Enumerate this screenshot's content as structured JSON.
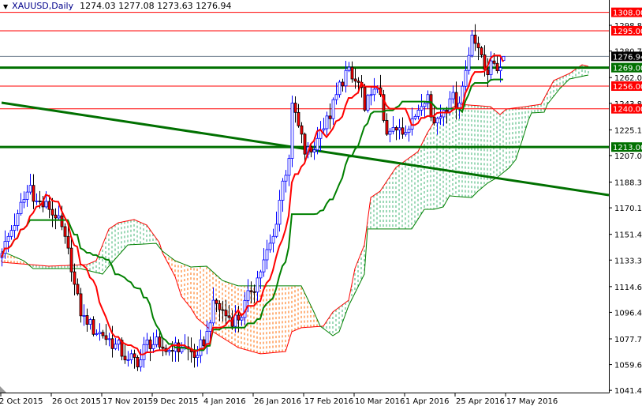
{
  "header": {
    "symbol": "XAUUSD,Daily",
    "ohlc": "1274.03 1277.08 1273.63 1276.94",
    "open": 1274.03,
    "high": 1277.08,
    "low": 1273.63,
    "close": 1276.94
  },
  "colors": {
    "bull": "#0000ff",
    "bear_body": "#ff0000",
    "bear_wick": "#000000",
    "tenkan": "#ff0000",
    "kijun": "#008000",
    "span_a": "#ff0000",
    "span_b": "#008000",
    "cloud_bull": "#3cb371",
    "cloud_bear": "#ff6a00",
    "support": "#ff0000",
    "resistance_green": "#007000",
    "price_line": "#708090"
  },
  "chart_data": {
    "type": "candlestick",
    "title": "XAUUSD,Daily",
    "ylim": [
      1041.45,
      1316.7
    ],
    "y_ticks": [
      "1298.85",
      "1280.70",
      "1262.00",
      "1243.85",
      "1225.15",
      "1207.00",
      "1188.30",
      "1170.15",
      "1151.45",
      "1133.30",
      "1114.60",
      "1096.45",
      "1077.75",
      "1059.60",
      "1041.45"
    ],
    "x_ticks": [
      {
        "bar": 0,
        "label": "2 Oct 2015"
      },
      {
        "bar": 16,
        "label": "26 Oct 2015"
      },
      {
        "bar": 32,
        "label": "17 Nov 2015"
      },
      {
        "bar": 48,
        "label": "9 Dec 2015"
      },
      {
        "bar": 64,
        "label": "4 Jan 2016"
      },
      {
        "bar": 80,
        "label": "26 Jan 2016"
      },
      {
        "bar": 96,
        "label": "17 Feb 2016"
      },
      {
        "bar": 112,
        "label": "10 Mar 2016"
      },
      {
        "bar": 128,
        "label": "1 Apr 2016"
      },
      {
        "bar": 144,
        "label": "25 Apr 2016"
      },
      {
        "bar": 160,
        "label": "17 May 2016"
      }
    ],
    "bar_count": 160,
    "close_keypoints": [
      [
        0,
        1138
      ],
      [
        5,
        1166
      ],
      [
        9,
        1186
      ],
      [
        11,
        1175
      ],
      [
        15,
        1169
      ],
      [
        17,
        1163
      ],
      [
        20,
        1150
      ],
      [
        22,
        1125
      ],
      [
        25,
        1094
      ],
      [
        27,
        1088
      ],
      [
        32,
        1080
      ],
      [
        36,
        1074
      ],
      [
        40,
        1063
      ],
      [
        44,
        1063
      ],
      [
        46,
        1077
      ],
      [
        50,
        1072
      ],
      [
        54,
        1069
      ],
      [
        57,
        1072
      ],
      [
        62,
        1066
      ],
      [
        65,
        1083
      ],
      [
        67,
        1105
      ],
      [
        71,
        1094
      ],
      [
        75,
        1091
      ],
      [
        79,
        1111
      ],
      [
        82,
        1125
      ],
      [
        86,
        1150
      ],
      [
        89,
        1189
      ],
      [
        91,
        1205
      ],
      [
        92,
        1244
      ],
      [
        94,
        1228
      ],
      [
        96,
        1208
      ],
      [
        99,
        1211
      ],
      [
        101,
        1225
      ],
      [
        104,
        1233
      ],
      [
        106,
        1250
      ],
      [
        109,
        1267
      ],
      [
        111,
        1261
      ],
      [
        114,
        1255
      ],
      [
        115,
        1239
      ],
      [
        117,
        1250
      ],
      [
        120,
        1250
      ],
      [
        122,
        1222
      ],
      [
        125,
        1225
      ],
      [
        127,
        1222
      ],
      [
        130,
        1233
      ],
      [
        132,
        1239
      ],
      [
        135,
        1250
      ],
      [
        137,
        1230
      ],
      [
        140,
        1239
      ],
      [
        142,
        1247
      ],
      [
        145,
        1244
      ],
      [
        147,
        1267
      ],
      [
        149,
        1292
      ],
      [
        151,
        1283
      ],
      [
        152,
        1278
      ],
      [
        154,
        1264
      ],
      [
        156,
        1272
      ],
      [
        158,
        1269
      ],
      [
        159,
        1276.94
      ]
    ],
    "senkou_a": [
      [
        0,
        1131.8
      ],
      [
        15,
        1129.0
      ],
      [
        27,
        1130.1
      ],
      [
        30,
        1132.9
      ],
      [
        34,
        1155.2
      ],
      [
        37,
        1159.6
      ],
      [
        42,
        1161.9
      ],
      [
        46,
        1158.0
      ],
      [
        50,
        1145.7
      ],
      [
        51,
        1138.5
      ],
      [
        55,
        1121.7
      ],
      [
        57,
        1107.8
      ],
      [
        60,
        1099.5
      ],
      [
        62,
        1092.2
      ],
      [
        67,
        1082.8
      ],
      [
        75,
        1071.6
      ],
      [
        82,
        1067.2
      ],
      [
        90,
        1068.8
      ],
      [
        92,
        1082.8
      ],
      [
        95,
        1085.6
      ],
      [
        102,
        1086.7
      ],
      [
        105,
        1096.7
      ],
      [
        110,
        1105.0
      ],
      [
        112,
        1127.3
      ],
      [
        115,
        1144.0
      ],
      [
        117,
        1177.4
      ],
      [
        120,
        1181.9
      ],
      [
        125,
        1198.6
      ],
      [
        132,
        1209.8
      ],
      [
        135,
        1223.1
      ],
      [
        137,
        1230.4
      ],
      [
        142,
        1239.8
      ],
      [
        145,
        1243.2
      ],
      [
        155,
        1241.5
      ],
      [
        158,
        1235.9
      ],
      [
        160,
        1239.8
      ],
      [
        166,
        1241.5
      ],
      [
        171,
        1243.2
      ],
      [
        175,
        1259.9
      ],
      [
        180,
        1264.9
      ],
      [
        184,
        1271.0
      ],
      [
        186,
        1269.9
      ]
    ],
    "senkou_b": [
      [
        0,
        1139.6
      ],
      [
        7,
        1132.9
      ],
      [
        10,
        1127.3
      ],
      [
        25,
        1127.3
      ],
      [
        32,
        1123.4
      ],
      [
        34,
        1129.0
      ],
      [
        40,
        1144.0
      ],
      [
        49,
        1145.1
      ],
      [
        51,
        1139.6
      ],
      [
        55,
        1132.9
      ],
      [
        60,
        1128.4
      ],
      [
        65,
        1129.0
      ],
      [
        70,
        1118.9
      ],
      [
        75,
        1115.1
      ],
      [
        95,
        1115.1
      ],
      [
        99,
        1096.7
      ],
      [
        101,
        1086.7
      ],
      [
        105,
        1080.0
      ],
      [
        107,
        1082.8
      ],
      [
        110,
        1101.1
      ],
      [
        115,
        1123.4
      ],
      [
        116,
        1155.2
      ],
      [
        130,
        1155.2
      ],
      [
        134,
        1169.1
      ],
      [
        137,
        1169.1
      ],
      [
        140,
        1170.8
      ],
      [
        142,
        1178.6
      ],
      [
        149,
        1177.4
      ],
      [
        151,
        1181.9
      ],
      [
        154,
        1187.5
      ],
      [
        157,
        1191.4
      ],
      [
        161,
        1198.6
      ],
      [
        163,
        1204.2
      ],
      [
        165,
        1217.6
      ],
      [
        167,
        1232.0
      ],
      [
        168,
        1237.1
      ],
      [
        172,
        1237.6
      ],
      [
        173,
        1243.2
      ],
      [
        177,
        1254.3
      ],
      [
        180,
        1261.0
      ],
      [
        186,
        1263.8
      ]
    ],
    "tenkan_period": 9,
    "kijun_period": 26,
    "trendline": {
      "from": [
        0,
        1244.3
      ],
      "to": [
        192.5,
        1179.1
      ]
    },
    "levels": [
      {
        "price": 1308.0,
        "label": "1308.00",
        "kind": "red"
      },
      {
        "price": 1295.0,
        "label": "1295.00",
        "kind": "red"
      },
      {
        "price": 1276.94,
        "label": "1276.94",
        "kind": "price"
      },
      {
        "price": 1269.0,
        "label": "1269.00",
        "kind": "green"
      },
      {
        "price": 1256.0,
        "label": "1256.00",
        "kind": "red"
      },
      {
        "price": 1240.0,
        "label": "1240.00",
        "kind": "red"
      },
      {
        "price": 1213.0,
        "label": "1213.00",
        "kind": "green"
      }
    ]
  }
}
